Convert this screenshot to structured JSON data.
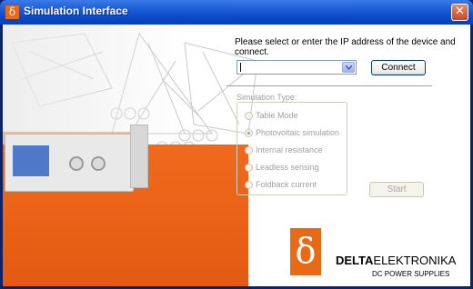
{
  "window": {
    "title": "Simulation Interface",
    "close_icon": "close-icon",
    "app_icon": "delta-icon",
    "app_icon_glyph": "δ"
  },
  "connection": {
    "prompt": "Please select or enter the IP address of the device and connect.",
    "ip_value": "",
    "connect_label": "Connect"
  },
  "simulation": {
    "label": "Simulation Type:",
    "options": [
      {
        "label": "Table Mode",
        "selected": false
      },
      {
        "label": "Photovoltaic simulation",
        "selected": true
      },
      {
        "label": "Internal resistance",
        "selected": false
      },
      {
        "label": "Leadless sensing",
        "selected": false
      },
      {
        "label": "Foldback current",
        "selected": false
      }
    ],
    "start_label": "Start",
    "enabled": false
  },
  "brand": {
    "mark_glyph": "δ",
    "name_bold": "DELTA",
    "name_rest": "ELEKTRONIKA",
    "subtitle": "DC POWER SUPPLIES",
    "accent": "#E86A17"
  }
}
